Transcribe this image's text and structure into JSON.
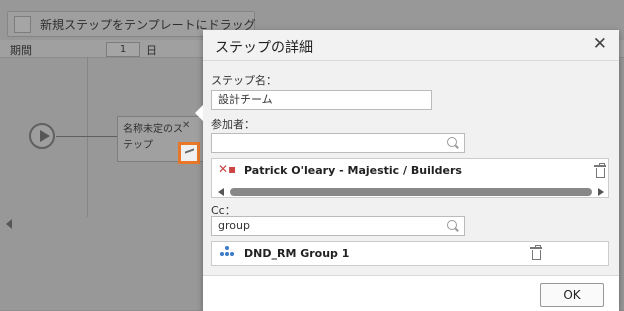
{
  "background": {
    "drag_label": "新規ステップをテンプレートにドラッグ",
    "period_label": "期間",
    "day_value": "1",
    "day_unit": "日",
    "step_name": "名称未定のステップ",
    "step_close": "✕"
  },
  "dialog": {
    "title": "ステップの詳細",
    "close": "✕",
    "step_name_label": "ステップ名：",
    "step_name_value": "設計チーム",
    "participants_label": "参加者：",
    "participants_search_value": "",
    "participant_name": "Patrick O'leary - Majestic / Builders",
    "cc_label": "Cc：",
    "cc_search_value": "group",
    "cc_name": "DND_RM Group 1",
    "ok_label": "OK"
  },
  "colors": {
    "highlight": "#e8772a",
    "overlay": "rgba(40,40,40,0.42)"
  }
}
